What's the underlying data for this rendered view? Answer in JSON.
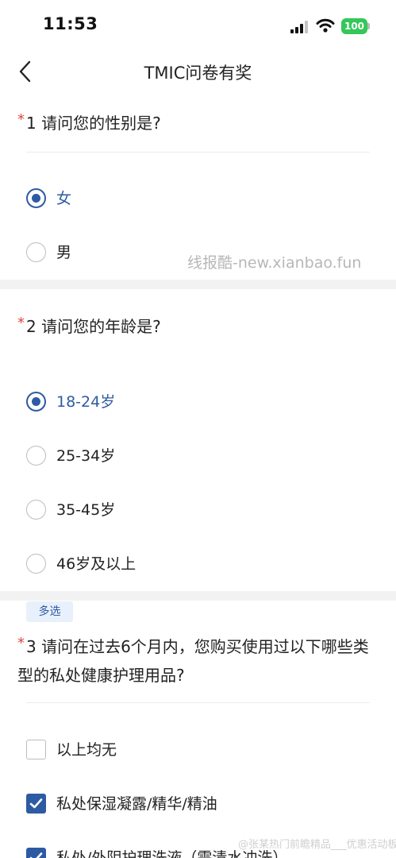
{
  "status_bar": {
    "time": "11:53",
    "battery": "100"
  },
  "nav": {
    "title": "TMIC问卷有奖"
  },
  "questions": [
    {
      "required_mark": "*",
      "title": "1 请问您的性别是?",
      "options": [
        {
          "label": "女",
          "selected": true
        },
        {
          "label": "男",
          "selected": false
        }
      ]
    },
    {
      "required_mark": "*",
      "title": "2 请问您的年龄是?",
      "options": [
        {
          "label": "18-24岁",
          "selected": true
        },
        {
          "label": "25-34岁",
          "selected": false
        },
        {
          "label": "35-45岁",
          "selected": false
        },
        {
          "label": "46岁及以上",
          "selected": false
        }
      ]
    },
    {
      "tag": "多选",
      "required_mark": "*",
      "title": "3 请问在过去6个月内，您购买使用过以下哪些类型的私处健康护理用品?",
      "options": [
        {
          "label": "以上均无",
          "selected": false
        },
        {
          "label": "私处保湿凝露/精华/精油",
          "selected": true
        },
        {
          "label": "私处/外阴护理洗液（需清水冲洗）",
          "selected": true
        }
      ]
    }
  ],
  "watermark": "线报酷-new.xianbao.fun",
  "bottom_watermark": "@张某热门前瞻精品___优惠活动板",
  "colors": {
    "accent": "#2d5ba3",
    "required": "#e0463b",
    "battery": "#34c759",
    "tag_bg": "#e8f0fb"
  }
}
